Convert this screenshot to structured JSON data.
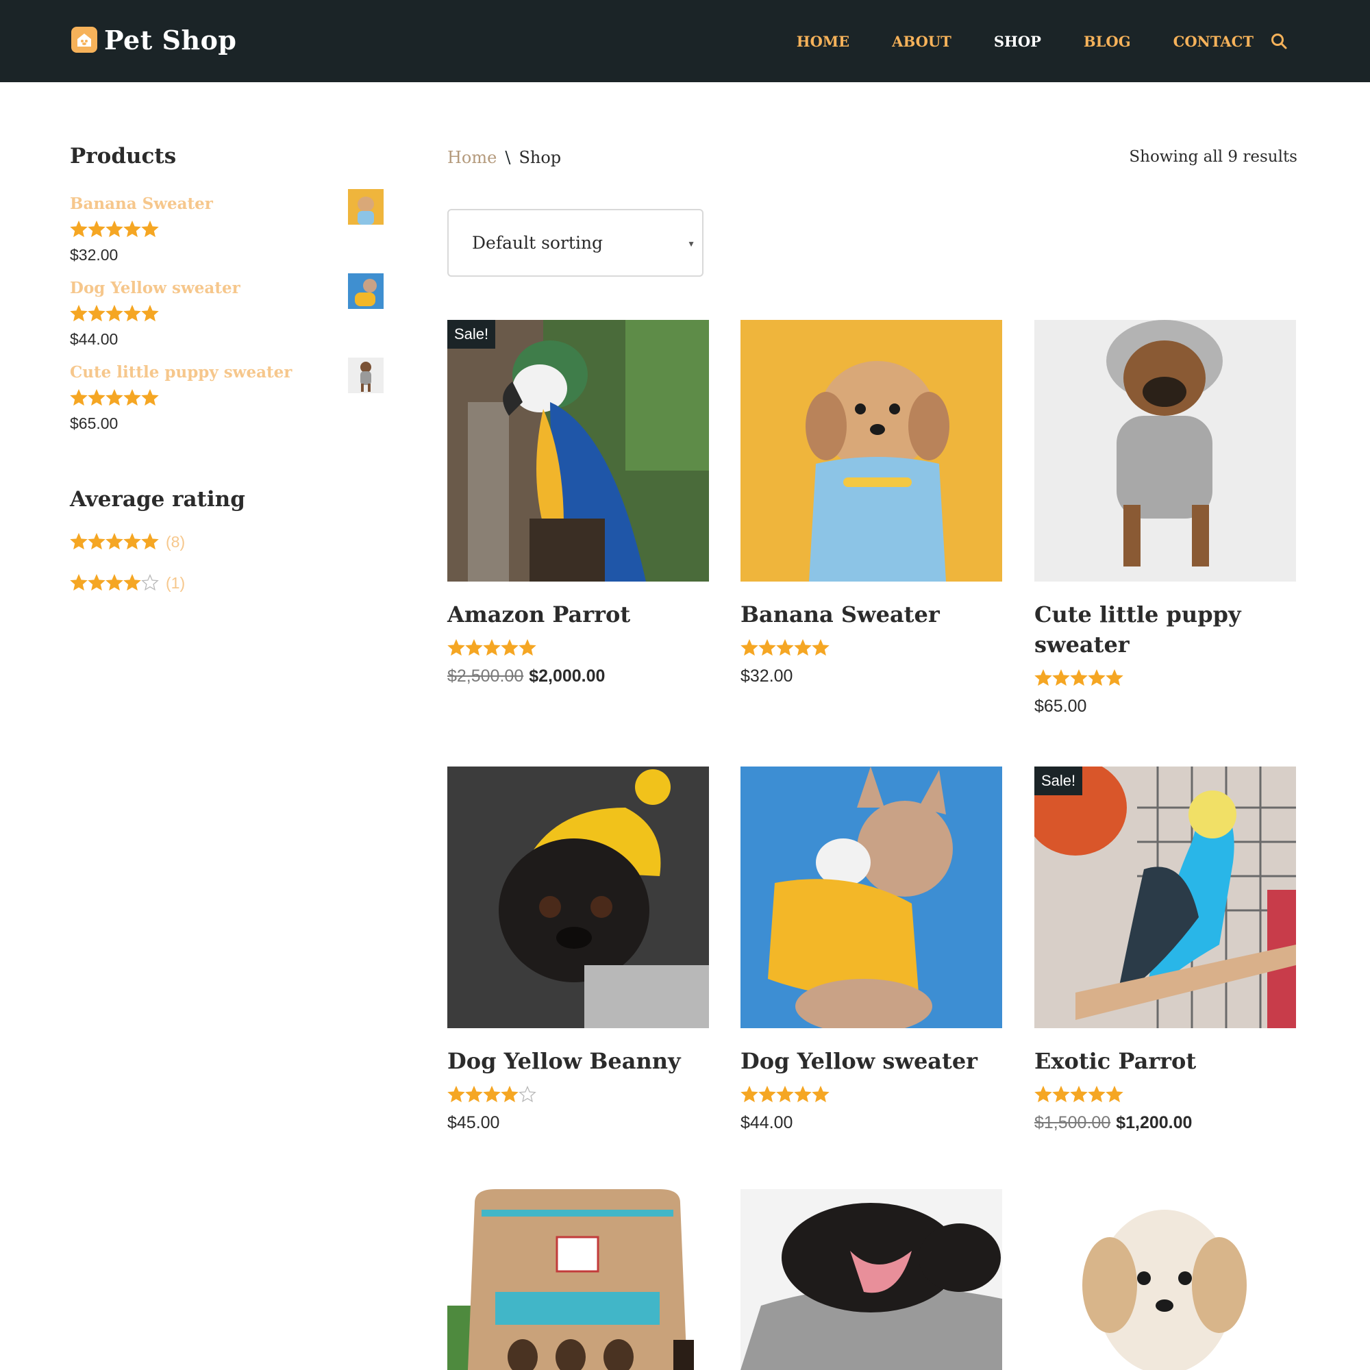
{
  "header": {
    "logo_text": "Pet Shop",
    "nav": [
      "HOME",
      "ABOUT",
      "SHOP",
      "BLOG",
      "CONTACT"
    ],
    "active_nav": "SHOP"
  },
  "colors": {
    "header_bg": "#1b2427",
    "accent": "#f6b25a",
    "star": "#f5a623",
    "link_faded": "#f6c78c"
  },
  "sidebar": {
    "products_title": "Products",
    "products": [
      {
        "name": "Banana Sweater",
        "rating": 5,
        "price": "$32.00"
      },
      {
        "name": "Dog Yellow sweater",
        "rating": 5,
        "price": "$44.00"
      },
      {
        "name": "Cute little puppy sweater",
        "rating": 5,
        "price": "$65.00"
      }
    ],
    "rating_title": "Average rating",
    "ratings": [
      {
        "stars": 5,
        "count": "(8)"
      },
      {
        "stars": 4,
        "count": "(1)"
      }
    ]
  },
  "breadcrumb": {
    "home": "Home",
    "separator": "\\",
    "current": "Shop"
  },
  "result_count": "Showing all 9 results",
  "sort": {
    "selected": "Default sorting"
  },
  "products": [
    {
      "title": "Amazon Parrot",
      "rating": 5,
      "old_price": "$2,500.00",
      "price": "$2,000.00",
      "sale": "Sale!",
      "image": "parrot-blue-yellow"
    },
    {
      "title": "Banana Sweater",
      "rating": 5,
      "price": "$32.00",
      "image": "dog-yellow-bg"
    },
    {
      "title": "Cute little puppy sweater",
      "rating": 5,
      "price": "$65.00",
      "image": "pug-grey-hoodie"
    },
    {
      "title": "Dog Yellow Beanny",
      "rating": 4,
      "price": "$45.00",
      "image": "pug-yellow-beanie"
    },
    {
      "title": "Dog Yellow sweater",
      "rating": 5,
      "price": "$44.00",
      "image": "frenchie-yellow-hoodie"
    },
    {
      "title": "Exotic Parrot",
      "rating": 5,
      "old_price": "$1,500.00",
      "price": "$1,200.00",
      "sale": "Sale!",
      "image": "budgie-blue"
    },
    {
      "title": "",
      "image": "chicken-treats-bag"
    },
    {
      "title": "",
      "image": "pug-yawning"
    },
    {
      "title": "",
      "image": "white-puppy"
    }
  ]
}
